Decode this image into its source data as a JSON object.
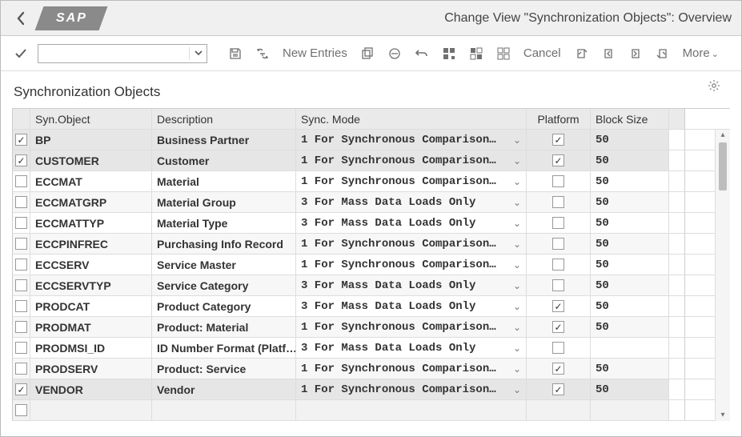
{
  "header": {
    "logo": "SAP",
    "title": "Change View \"Synchronization Objects\": Overview"
  },
  "toolbar": {
    "command_value": "",
    "new_entries": "New Entries",
    "cancel": "Cancel",
    "more": "More"
  },
  "section": {
    "title": "Synchronization Objects"
  },
  "table": {
    "headers": {
      "syn_object": "Syn.Object",
      "description": "Description",
      "sync_mode": "Sync. Mode",
      "platform": "Platform",
      "block_size": "Block Size"
    },
    "rows": [
      {
        "selected": true,
        "syn_object": "BP",
        "description": "Business Partner",
        "sync_mode": "1 For Synchronous Comparison…",
        "platform": true,
        "block_size": "50"
      },
      {
        "selected": true,
        "syn_object": "CUSTOMER",
        "description": "Customer",
        "sync_mode": "1 For Synchronous Comparison…",
        "platform": true,
        "block_size": "50"
      },
      {
        "selected": false,
        "syn_object": "ECCMAT",
        "description": "Material",
        "sync_mode": "1 For Synchronous Comparison…",
        "platform": false,
        "block_size": "50"
      },
      {
        "selected": false,
        "syn_object": "ECCMATGRP",
        "description": "Material Group",
        "sync_mode": "3 For Mass Data Loads Only",
        "platform": false,
        "block_size": "50"
      },
      {
        "selected": false,
        "syn_object": "ECCMATTYP",
        "description": "Material Type",
        "sync_mode": "3 For Mass Data Loads Only",
        "platform": false,
        "block_size": "50"
      },
      {
        "selected": false,
        "syn_object": "ECCPINFREC",
        "description": "Purchasing Info Record",
        "sync_mode": "1 For Synchronous Comparison…",
        "platform": false,
        "block_size": "50"
      },
      {
        "selected": false,
        "syn_object": "ECCSERV",
        "description": "Service Master",
        "sync_mode": "1 For Synchronous Comparison…",
        "platform": false,
        "block_size": "50"
      },
      {
        "selected": false,
        "syn_object": "ECCSERVTYP",
        "description": "Service Category",
        "sync_mode": "3 For Mass Data Loads Only",
        "platform": false,
        "block_size": "50"
      },
      {
        "selected": false,
        "syn_object": "PRODCAT",
        "description": "Product Category",
        "sync_mode": "3 For Mass Data Loads Only",
        "platform": true,
        "block_size": "50"
      },
      {
        "selected": false,
        "syn_object": "PRODMAT",
        "description": "Product: Material",
        "sync_mode": "1 For Synchronous Comparison…",
        "platform": true,
        "block_size": "50"
      },
      {
        "selected": false,
        "syn_object": "PRODMSI_ID",
        "description": "ID Number Format (Platf…",
        "sync_mode": "3 For Mass Data Loads Only",
        "platform": false,
        "block_size": ""
      },
      {
        "selected": false,
        "syn_object": "PRODSERV",
        "description": "Product: Service",
        "sync_mode": "1 For Synchronous Comparison…",
        "platform": true,
        "block_size": "50"
      },
      {
        "selected": true,
        "syn_object": "VENDOR",
        "description": "Vendor",
        "sync_mode": "1 For Synchronous Comparison…",
        "platform": true,
        "block_size": "50"
      },
      {
        "empty": true
      }
    ]
  }
}
